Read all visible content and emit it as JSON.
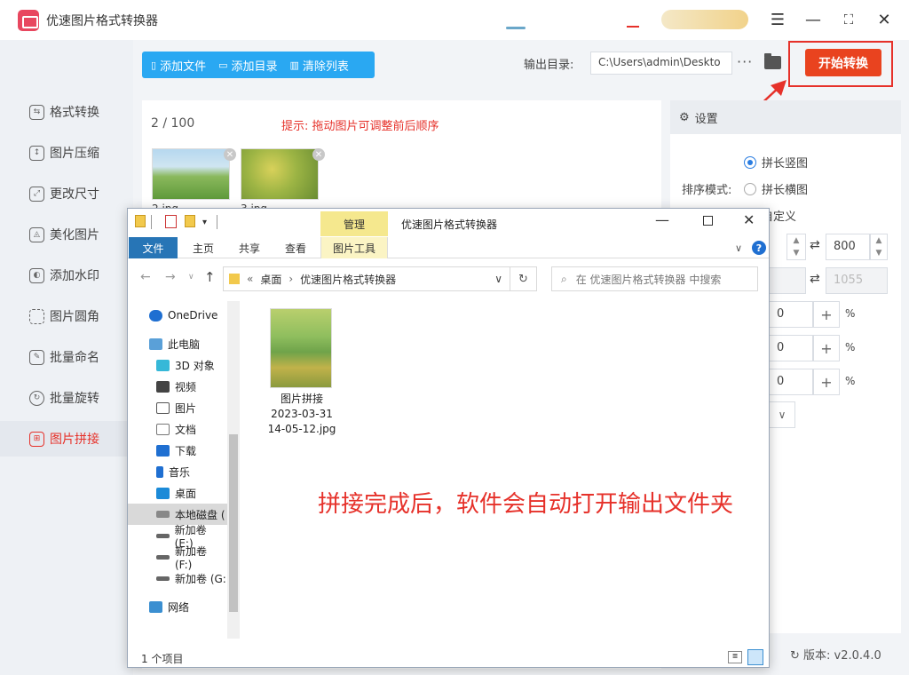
{
  "app": {
    "title": "优速图片格式转换器"
  },
  "sidebar": {
    "items": [
      {
        "label": "格式转换",
        "icon": "format-convert-icon"
      },
      {
        "label": "图片压缩",
        "icon": "compress-icon"
      },
      {
        "label": "更改尺寸",
        "icon": "resize-icon"
      },
      {
        "label": "美化图片",
        "icon": "beautify-icon"
      },
      {
        "label": "添加水印",
        "icon": "watermark-icon"
      },
      {
        "label": "图片圆角",
        "icon": "round-corner-icon"
      },
      {
        "label": "批量命名",
        "icon": "rename-icon"
      },
      {
        "label": "批量旋转",
        "icon": "rotate-icon"
      },
      {
        "label": "图片拼接",
        "icon": "stitch-icon",
        "active": true
      }
    ]
  },
  "toolbar": {
    "add_file": "添加文件",
    "add_dir": "添加目录",
    "clear_list": "清除列表",
    "output_label": "输出目录:",
    "output_path": "C:\\Users\\admin\\Deskto",
    "more": "···",
    "start": "开始转换"
  },
  "list": {
    "count": "2 / 100",
    "hint": "提示: 拖动图片可调整前后顺序",
    "thumbs": [
      "2.jpg",
      "3.jpg"
    ]
  },
  "settings": {
    "title": "设置",
    "sort_label": "排序模式:",
    "options": [
      "拼长竖图",
      "拼长横图",
      "自定义"
    ],
    "width": "800",
    "height": "1055",
    "margins": [
      "0",
      "0",
      "0"
    ],
    "percent": "%"
  },
  "version": "版本: v2.0.4.0",
  "explorer": {
    "title": "优速图片格式转换器",
    "manage": "管理",
    "tabs": [
      "文件",
      "主页",
      "共享",
      "查看",
      "图片工具"
    ],
    "path": [
      "桌面",
      "优速图片格式转换器"
    ],
    "search_placeholder": "在 优速图片格式转换器 中搜索",
    "nav": [
      "OneDrive",
      "此电脑",
      "3D 对象",
      "视频",
      "图片",
      "文档",
      "下载",
      "音乐",
      "桌面",
      "本地磁盘 (",
      "新加卷 (E:)",
      "新加卷 (F:)",
      "新加卷 (G:",
      "网络"
    ],
    "file_name": "图片拼接\n2023-03-31\n14-05-12.jpg",
    "file_line1": "图片拼接",
    "file_line2": "2023-03-31",
    "file_line3": "14-05-12.jpg",
    "status": "1 个项目",
    "annotation": "拼接完成后，软件会自动打开输出文件夹"
  },
  "colors": {
    "accent": "#e6312a",
    "toolbar_blue": "#2aa8f2",
    "start_btn": "#e9431f",
    "explorer_file_tab": "#2775b6"
  }
}
